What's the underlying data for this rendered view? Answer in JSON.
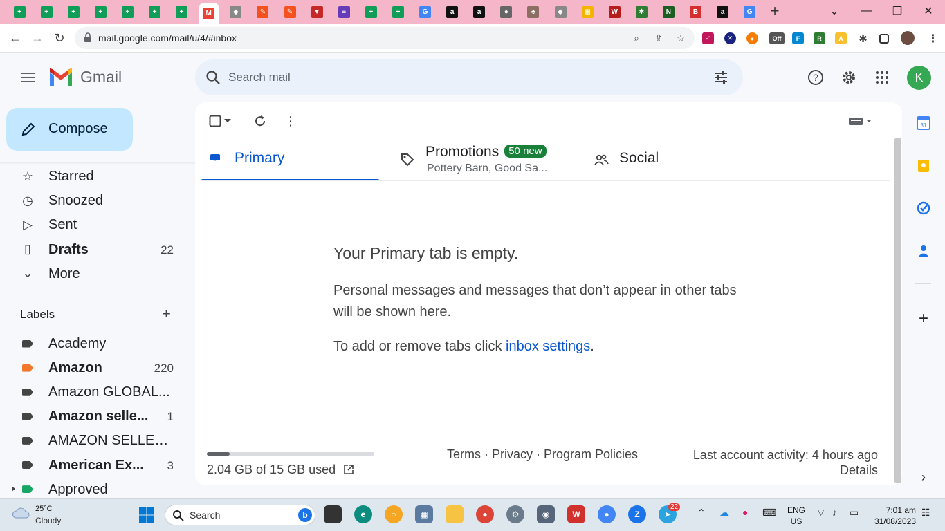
{
  "browser": {
    "url": "mail.google.com/mail/u/4/#inbox",
    "tab_favicons": [
      "sheets",
      "sheets",
      "sheets",
      "sheets",
      "sheets",
      "sheets",
      "sheets",
      "gmail",
      "app",
      "pen",
      "pen",
      "triangle",
      "forms",
      "sheets",
      "sheets",
      "google",
      "amazon",
      "amazon",
      "globe",
      "plant",
      "app",
      "grid",
      "vw",
      "puzzle",
      "n",
      "big",
      "amazon",
      "google"
    ],
    "ext_off_label": "Off"
  },
  "gmail": {
    "logo_text": "Gmail",
    "search_placeholder": "Search mail",
    "avatar_letter": "K",
    "compose_label": "Compose"
  },
  "nav": {
    "items": [
      {
        "label": "Starred",
        "icon": "star-icon",
        "count": ""
      },
      {
        "label": "Snoozed",
        "icon": "clock-icon",
        "count": ""
      },
      {
        "label": "Sent",
        "icon": "send-icon",
        "count": ""
      },
      {
        "label": "Drafts",
        "icon": "draft-icon",
        "count": "22"
      },
      {
        "label": "More",
        "icon": "chevron-down-icon",
        "count": ""
      }
    ],
    "labels_heading": "Labels",
    "labels": [
      {
        "label": "Academy",
        "count": "",
        "color": "#444444",
        "bold": false
      },
      {
        "label": "Amazon",
        "count": "220",
        "color": "#f4782b",
        "bold": true
      },
      {
        "label": "Amazon GLOBAL...",
        "count": "",
        "color": "#444444",
        "bold": false
      },
      {
        "label": "Amazon selle...",
        "count": "1",
        "color": "#444444",
        "bold": true
      },
      {
        "label": "AMAZON SELLER...",
        "count": "",
        "color": "#444444",
        "bold": false
      },
      {
        "label": "American Ex...",
        "count": "3",
        "color": "#444444",
        "bold": true
      },
      {
        "label": "Approved",
        "count": "",
        "color": "#16a765",
        "bold": false
      }
    ]
  },
  "tabs": {
    "primary": "Primary",
    "promotions": "Promotions",
    "promotions_badge": "50 new",
    "promotions_sub": "Pottery Barn, Good Sa...",
    "social": "Social"
  },
  "empty": {
    "heading": "Your Primary tab is empty.",
    "body": "Personal messages and messages that don’t appear in other tabs will be shown here.",
    "settings_prefix": "To add or remove tabs click ",
    "settings_link": "inbox settings",
    "settings_suffix": "."
  },
  "footer": {
    "storage": "2.04 GB of 15 GB used",
    "storage_fraction": 0.136,
    "links": "Terms · Privacy · Program Policies",
    "activity": "Last account activity: 4 hours ago",
    "details": "Details"
  },
  "taskbar": {
    "temp": "25°C",
    "weather": "Cloudy",
    "search_label": "Search",
    "lang1": "ENG",
    "lang2": "US",
    "time": "7:01 am",
    "date": "31/08/2023",
    "telegram_badge": "22"
  },
  "colors": {
    "tabstrip": "#f4b6c8",
    "accent": "#0b57d0",
    "compose": "#c2e7ff",
    "badge": "#188038"
  }
}
